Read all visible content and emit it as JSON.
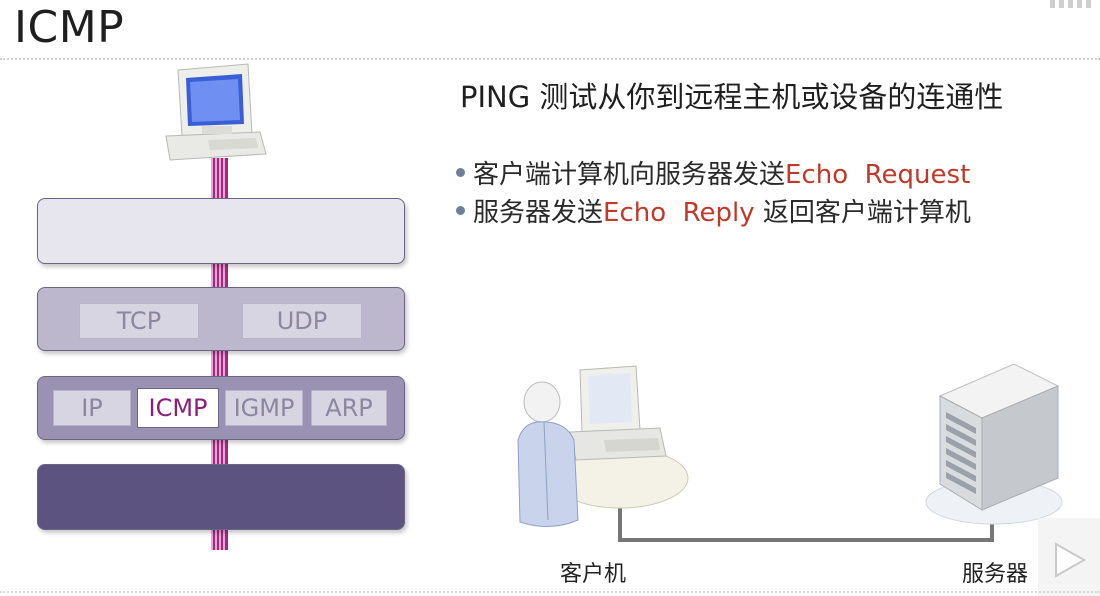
{
  "slide": {
    "title": "ICMP",
    "headline": "PING 测试从你到远程主机或设备的连通性"
  },
  "bullets": [
    {
      "prefix": "客户端计算机向服务器发送",
      "highlight": "Echo  Request",
      "suffix": ""
    },
    {
      "prefix": "服务器发送",
      "highlight": "Echo  Reply",
      "suffix": " 返回客户端计算机"
    }
  ],
  "stack": {
    "transport": [
      "TCP",
      "UDP"
    ],
    "internet": [
      "IP",
      "ICMP",
      "IGMP",
      "ARP"
    ],
    "active_protocol": "ICMP"
  },
  "diagram": {
    "client_label": "客户机",
    "server_label": "服务器"
  },
  "colors": {
    "highlight": "#c0392b",
    "active_protocol_text": "#8b1f79",
    "pipe": "#a3297e",
    "layer_dark": "#5d5381"
  },
  "icons": [
    "computer-icon",
    "client-user-icon",
    "server-tower-icon",
    "play-icon"
  ]
}
